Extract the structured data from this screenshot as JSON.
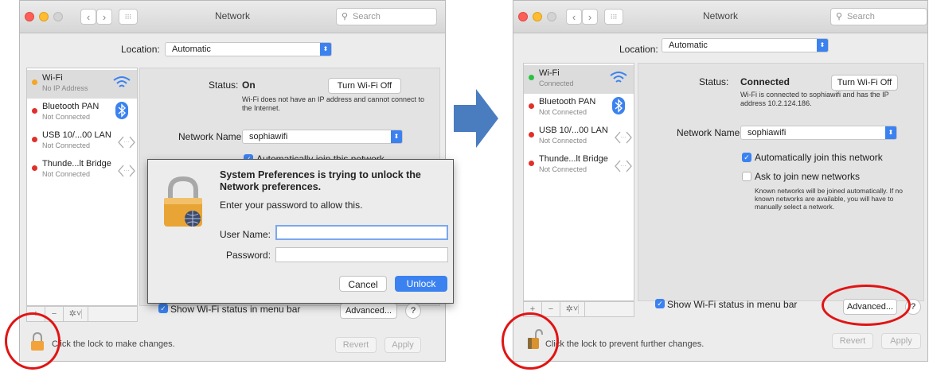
{
  "left": {
    "title": "Network",
    "search_placeholder": "Search",
    "location_label": "Location:",
    "location_value": "Automatic",
    "services": [
      {
        "name": "Wi-Fi",
        "status": "No IP Address",
        "dot": "#f5a623"
      },
      {
        "name": "Bluetooth PAN",
        "status": "Not Connected",
        "dot": "#e0302b"
      },
      {
        "name": "USB 10/...00 LAN",
        "status": "Not Connected",
        "dot": "#e0302b"
      },
      {
        "name": "Thunde...lt Bridge",
        "status": "Not Connected",
        "dot": "#e0302b"
      }
    ],
    "status_label": "Status:",
    "status_value": "On",
    "turn_wifi_off": "Turn Wi-Fi Off",
    "status_desc": "Wi-Fi does not have an IP address and cannot connect to the Internet.",
    "network_name_label": "Network Name:",
    "network_name_value": "sophiawifi",
    "auto_join": "Automatically join this network",
    "show_status": "Show Wi-Fi status in menu bar",
    "advanced": "Advanced...",
    "help": "?",
    "lock_text": "Click the lock to make changes.",
    "revert": "Revert",
    "apply": "Apply",
    "dialog": {
      "heading": "System Preferences is trying to unlock the Network preferences.",
      "prompt": "Enter your password to allow this.",
      "username_label": "User Name:",
      "password_label": "Password:",
      "cancel": "Cancel",
      "unlock": "Unlock"
    }
  },
  "right": {
    "title": "Network",
    "search_placeholder": "Search",
    "location_label": "Location:",
    "location_value": "Automatic",
    "services": [
      {
        "name": "Wi-Fi",
        "status": "Connected",
        "dot": "#29c23f"
      },
      {
        "name": "Bluetooth PAN",
        "status": "Not Connected",
        "dot": "#e0302b"
      },
      {
        "name": "USB 10/...00 LAN",
        "status": "Not Connected",
        "dot": "#e0302b"
      },
      {
        "name": "Thunde...lt Bridge",
        "status": "Not Connected",
        "dot": "#e0302b"
      }
    ],
    "status_label": "Status:",
    "status_value": "Connected",
    "turn_wifi_off": "Turn Wi-Fi Off",
    "status_desc": "Wi-Fi is connected to sophiawifi and has the IP address 10.2.124.186.",
    "network_name_label": "Network Name:",
    "network_name_value": "sophiawifi",
    "auto_join": "Automatically join this network",
    "ask_join": "Ask to join new networks",
    "ask_desc": "Known networks will be joined automatically. If no known networks are available, you will have to manually select a network.",
    "show_status": "Show Wi-Fi status in menu bar",
    "advanced": "Advanced...",
    "help": "?",
    "lock_text": "Click the lock to prevent further changes.",
    "revert": "Revert",
    "apply": "Apply"
  },
  "colors": {
    "annotation": "#e11414",
    "accent": "#3b82f0",
    "arrow": "#4a7cc0"
  }
}
